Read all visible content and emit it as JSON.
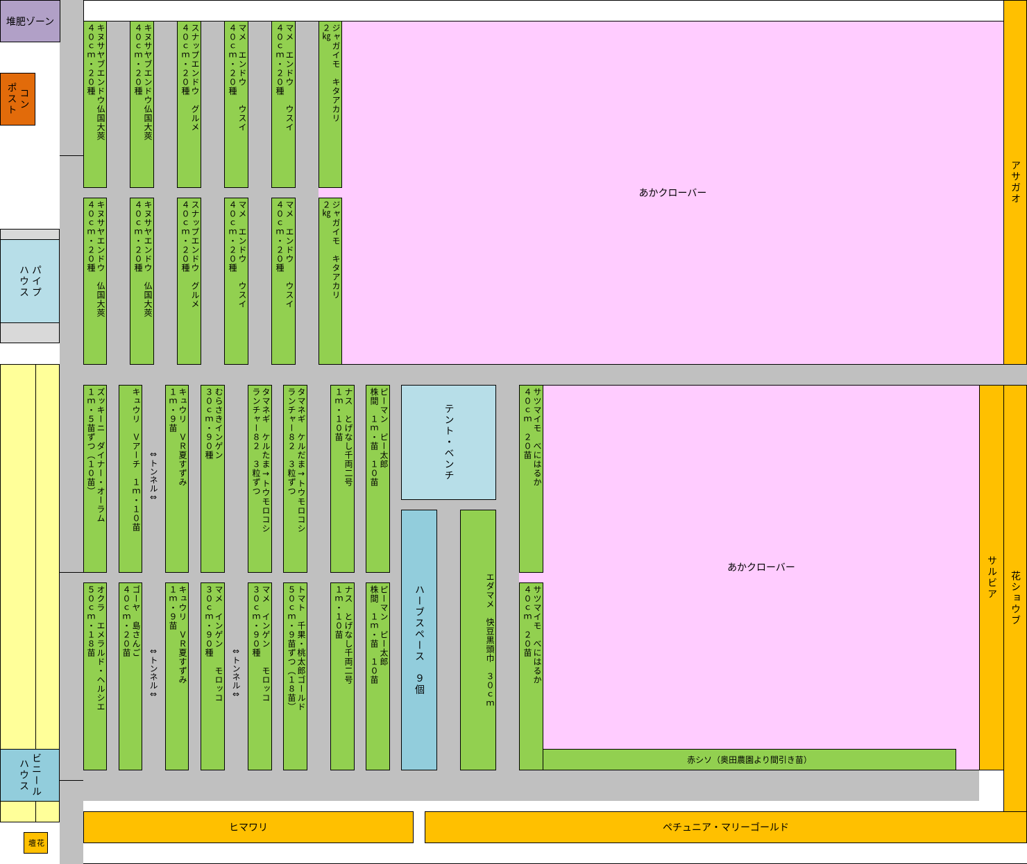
{
  "zones": {
    "compost_zone": "堆肥ゾーン",
    "compost": "コン\nポスト",
    "pipe_house": "パイプ\nハウス",
    "vinyl_house": "ビニール\nハウス",
    "flowerbed": "花\n壇",
    "tent_bench": "テント・ベンチ",
    "herb_space": "ハーブスペース　９個",
    "asagao": "アサガオ",
    "salvia": "サルビア",
    "hana_shoubu": "花ショウブ",
    "himawari": "ヒマワリ",
    "petunia": "ペチュニア・マリーゴールド",
    "clover_top": "あかクローバー",
    "clover_bottom": "あかクローバー",
    "akashiso": "赤シソ（奥田農園より間引き苗）"
  },
  "beds_top_row1": [
    "キヌサヤブエンドウ仏国大莢\n４０ｃｍ・２０種",
    "キヌサヤブエンドウ仏国大莢\n４０ｃｍ・２０種",
    "スナップエンドウ　グルメ\n４０ｃｍ・２０種",
    "マメ　エンドウ　　ウスイ\n４０ｃｍ・２０種",
    "マメ　エンドウ　　ウスイ\n４０ｃｍ・２０種",
    "ジャガイモ　キタアカリ\n２㎏"
  ],
  "beds_top_row2": [
    "キヌサヤエンドウ　仏国大莢\n４０ｃｍ・２０種",
    "キヌサヤエンドウ　仏国大莢\n４０ｃｍ・２０種",
    "スナップエンドウ　グルメ\n４０ｃｍ・２０種",
    "マメ　エンドウ　　ウスイ\n４０ｃｍ・２０種",
    "マメ　エンドウ　　ウスイ\n４０ｃｍ・２０種",
    "ジャガイモ　キタアカリ\n２㎏"
  ],
  "beds_bottom_row1": [
    "ズッキーニ　ダイナー・オーラム\n１ｍ・５苗ずつ（１０苗）",
    "キュウリ　Ｖアーチ　１ｍ・１０苗",
    "キュウリ　ＶＲ夏すずみ\n１ｍ・９苗",
    "むらさきインゲン\n３０ｃｍ・９０種",
    "タマネギ　ケルたま→トウモロコシ\nランチャー８２　３粒ずつ",
    "タマネギ　ケルだま→トウモロコシ\nランチャー８２　３粒ずつ",
    "ナス　とげなし千両二号\n１ｍ・１０苗",
    "ピーマン　ピー太郎\n株間　１ｍ・苗　１０苗",
    "サツマイモ　べにはるか\n４０ｃｍ　２０苗"
  ],
  "beds_bottom_row2": [
    "オクラ　エメラルド・ヘルシエ\n５０ｃｍ・１８苗",
    "ゴーヤ　島さんご\n４０ｃｍ・２０苗",
    "キュウリ　ＶＲ夏すずみ\n１ｍ・９苗",
    "マメ　インゲン　　モロッコ\n３０ｃｍ・９０種",
    "マメ　インゲン　　モロッコ\n３０ｃｍ・９０種",
    "トマト　千果・桃太郎ゴールド\n５０ｃｍ・９苗ずつ（１８苗）",
    "ナス　とげなし千両二号\n１ｍ・１０苗",
    "ピーマン　ピー太郎\n株間　１ｍ・苗　１０苗",
    "サツマイモ　べにはるか\n４０ｃｍ　２０苗"
  ],
  "edamame": "エダマメ　快豆黒頭巾　３０ｃｍ",
  "tunnels": [
    "⇔トンネル⇔",
    "⇔トンネル⇔",
    "⇔トンネル⇔"
  ],
  "colors": {
    "vegetable": "#92d050",
    "clover": "#ffccff",
    "flower": "#ffc000",
    "path": "#c0c0c0",
    "tent": "#b7dee8",
    "herb": "#92cddc",
    "house_yellow": "#ffff99",
    "compost_zone": "#b1a0c7",
    "compost": "#e26b0a"
  }
}
